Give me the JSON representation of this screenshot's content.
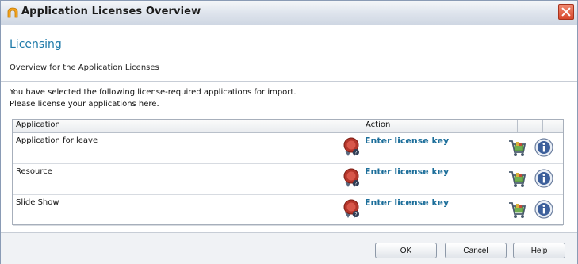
{
  "window": {
    "title": "Application Licenses Overview"
  },
  "header": {
    "title": "Licensing",
    "subtitle": "Overview for the Application Licenses"
  },
  "instructions": {
    "line1": "You have selected the following license-required applications for import.",
    "line2": "Please license your applications here."
  },
  "grid": {
    "columns": {
      "application": "Application",
      "action": "Action"
    },
    "rows": [
      {
        "name": "Application for leave",
        "action": "Enter license key"
      },
      {
        "name": "Resource",
        "action": "Enter license key"
      },
      {
        "name": "Slide Show",
        "action": "Enter license key"
      }
    ]
  },
  "buttons": {
    "ok": "OK",
    "cancel": "Cancel",
    "help": "Help"
  },
  "icons": {
    "app": "app-arch-icon",
    "license": "license-seal-icon",
    "cart": "shopping-cart-icon",
    "info": "info-icon",
    "close": "close-icon"
  },
  "colors": {
    "heading": "#1b78a8",
    "link": "#1c6e9a",
    "close": "#d8472b"
  }
}
